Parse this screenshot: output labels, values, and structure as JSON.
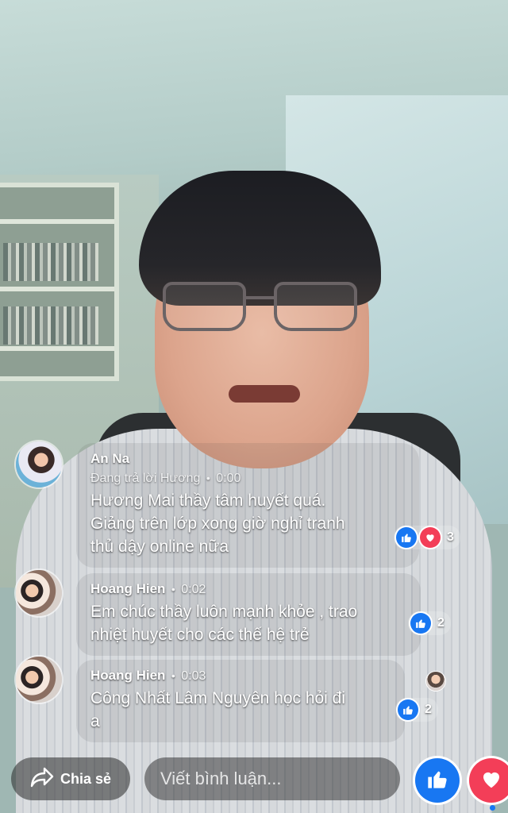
{
  "comments": [
    {
      "author": "An Na",
      "replying_to": "Đang trả lời Hương",
      "time": "0:00",
      "text_lines": [
        "Hương Mai  thầy tâm huyết quá.",
        "Giảng trên lớp xong giờ nghỉ tranh",
        "thủ dậy online nữa"
      ],
      "reactions": [
        "like",
        "love"
      ],
      "reaction_count": "3"
    },
    {
      "author": "Hoang Hien",
      "time": "0:02",
      "text_lines": [
        "Em chúc thầy luôn mạnh khỏe , trao",
        "nhiệt huyết cho các thế hệ trẻ"
      ],
      "reactions": [
        "like"
      ],
      "reaction_count": "2"
    },
    {
      "author": "Hoang Hien",
      "time": "0:03",
      "text_lines": [
        "Công Nhất Lâm Nguyên học hỏi đi",
        "a"
      ],
      "reactions": [
        "like"
      ],
      "reaction_count": "2"
    }
  ],
  "separator": "•",
  "bottom_bar": {
    "share_label": "Chia sẻ",
    "share_icon": "share-arrow-icon",
    "comment_placeholder": "Viết bình luận...",
    "like_icon": "thumbs-up-icon",
    "love_icon": "heart-icon"
  },
  "colors": {
    "like": "#1877f2",
    "love": "#f33e58"
  }
}
